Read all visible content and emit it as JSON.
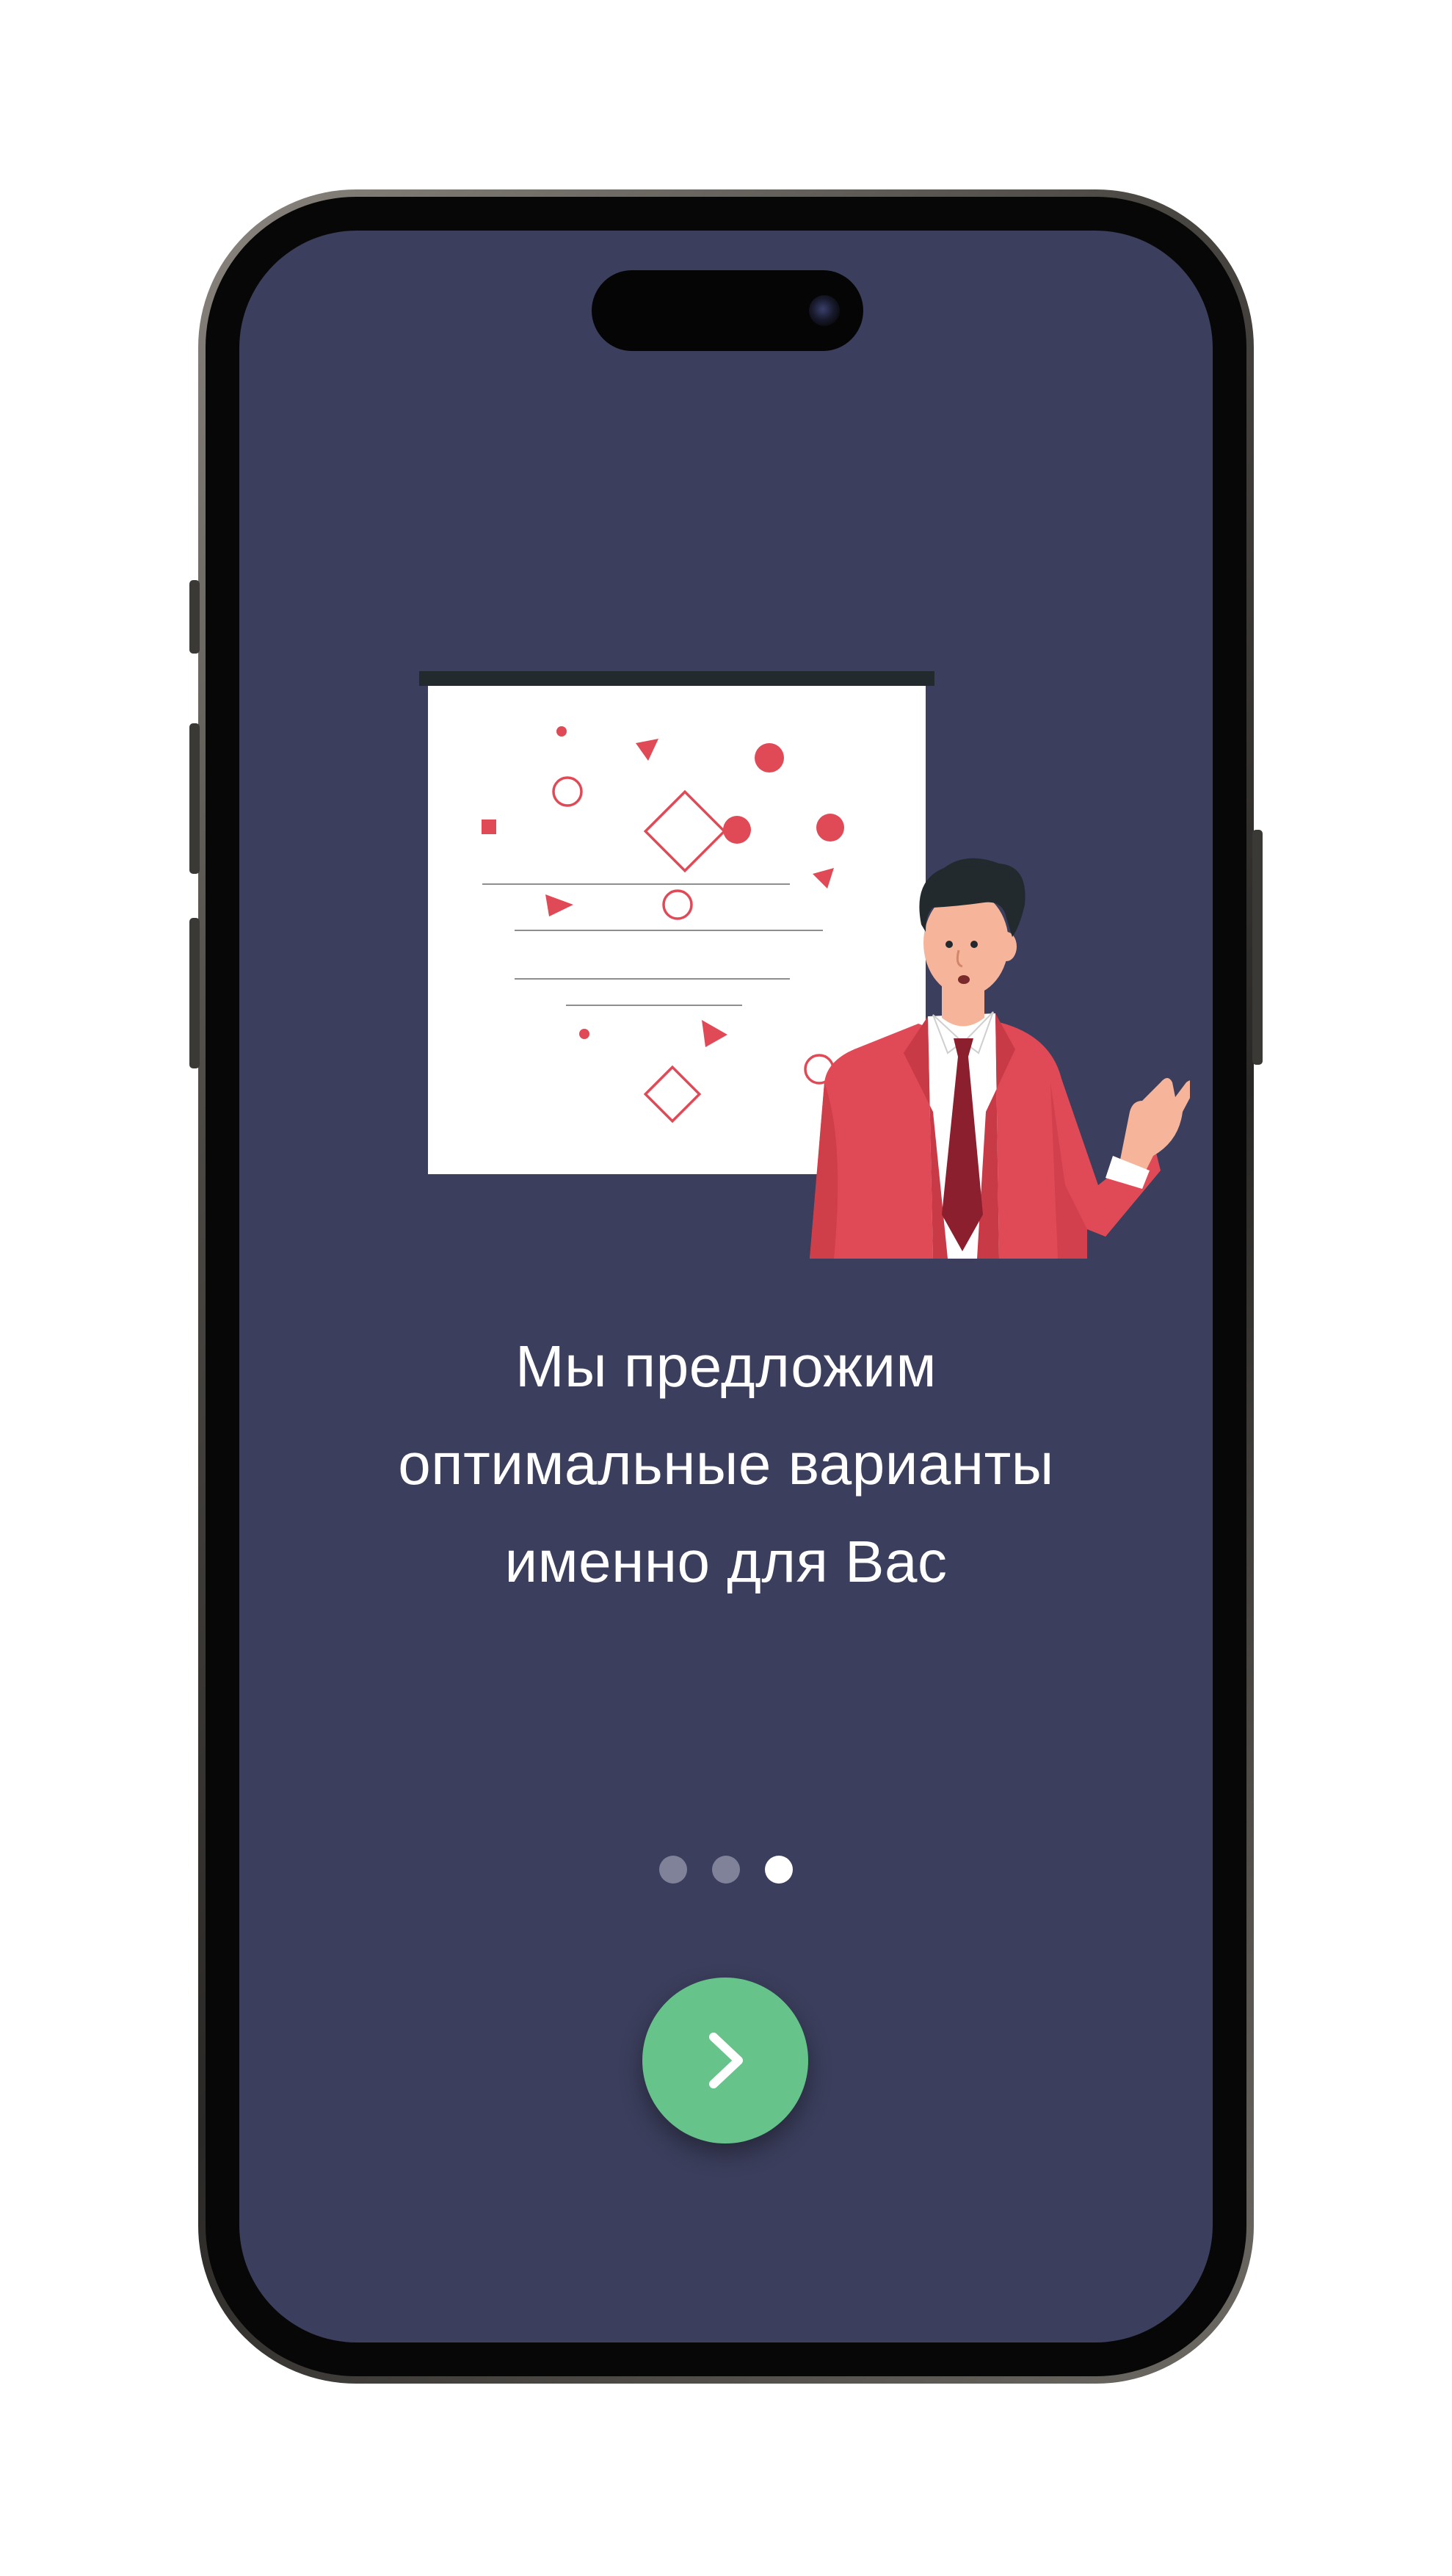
{
  "onboarding": {
    "headline_lines": [
      "Мы предложим",
      "оптимальные варианты",
      "именно для Вас"
    ],
    "pager": {
      "total": 3,
      "active_index": 2
    },
    "next_button": {
      "icon": "chevron-right-icon"
    },
    "illustration": {
      "icon": "presenter-with-whiteboard-illustration"
    }
  },
  "colors": {
    "screen_background": "#3b3e5c",
    "accent_green": "#66c38a",
    "accent_red": "#e04a56",
    "dot_inactive": "#7f8298",
    "dot_active": "#ffffff",
    "text": "#ffffff"
  }
}
